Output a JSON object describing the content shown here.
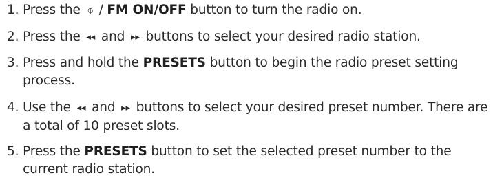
{
  "steps": [
    {
      "num": "1. ",
      "pre": "Press the ",
      "icon": "power-standby-icon",
      "icon_glyph": "⌽",
      "mid": " / ",
      "bold": "FM ON/OFF",
      "post": " button to turn the radio on."
    },
    {
      "num": "2. ",
      "pre": "Press the ",
      "icon_a": "rewind-icon",
      "glyph_a": "◂◂",
      "mid": " and ",
      "icon_b": "fast-forward-icon",
      "glyph_b": "▸▸",
      "post": " buttons to select your desired radio station."
    },
    {
      "num": "3. ",
      "pre": "Press and hold the ",
      "bold": "PRESETS",
      "post": " button to begin the radio preset setting process."
    },
    {
      "num": "4. ",
      "pre": "Use the ",
      "icon_a": "rewind-icon",
      "glyph_a": "◂◂",
      "mid": " and ",
      "icon_b": "fast-forward-icon",
      "glyph_b": "▸▸",
      "post": " buttons to select your desired preset number. There are a total of 10 preset slots."
    },
    {
      "num": "5. ",
      "pre": "Press the ",
      "bold": "PRESETS",
      "post": " button to set the selected preset number to the current radio station."
    }
  ]
}
